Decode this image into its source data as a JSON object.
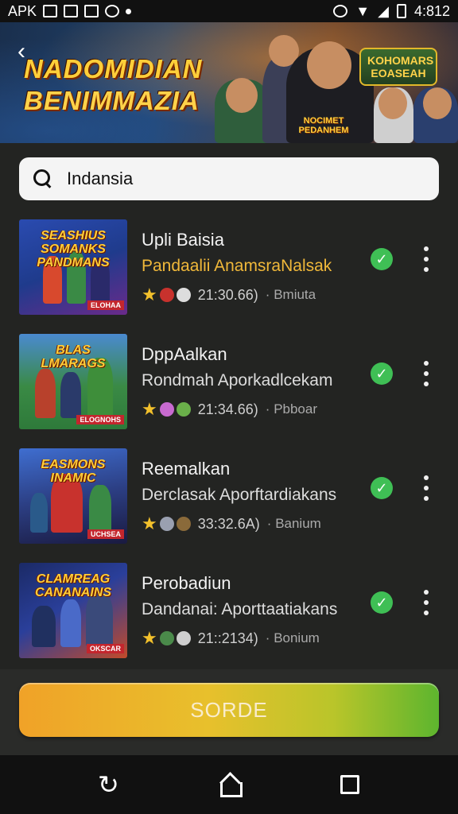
{
  "status_bar": {
    "left_label": "APK",
    "time": "4:812"
  },
  "banner": {
    "title_line1": "NADOMIDIAN",
    "title_line2": "BENIMMAZIA",
    "shirt_text": "NOCIMET PEDANHEM",
    "badge_text": "KOHOMARS EOASEAH"
  },
  "search": {
    "value": "Indansia",
    "placeholder": ""
  },
  "results": [
    {
      "thumb_title": "SEASHIUS SOMANKS PANDMANS",
      "thumb_tag": "ELOHAA",
      "name": "Upli Baisia",
      "subtitle": "Pandaalii AnamsraNalsak",
      "time": "21:30.66)",
      "category": "Bmiuta",
      "colors": [
        "#1f3b8c",
        "#d8492d",
        "#f2b92a"
      ]
    },
    {
      "thumb_title": "BLAS LMARAGS",
      "thumb_tag": "ELOGNOHS",
      "name": "DppAalkan",
      "subtitle": "Rondmah Aporkadlcekam",
      "time": "21:34.66)",
      "category": "Pbboar",
      "colors": [
        "#2e7a3a",
        "#b8412c",
        "#d8a62a"
      ]
    },
    {
      "thumb_title": "EASMONS INAMIC",
      "thumb_tag": "UCHSEA",
      "name": "Reemalkan",
      "subtitle": "Derclasak Aporftardiakans",
      "time": "33:32.6A)",
      "category": "Banium",
      "colors": [
        "#2c3f84",
        "#c8322d",
        "#3a8a45"
      ]
    },
    {
      "thumb_title": "CLAMREAG CANANAINS",
      "thumb_tag": "OKSCAR",
      "name": "Perobadiun",
      "subtitle": "Dandanai: Aporttaatiakans",
      "time": "21::2134)",
      "category": "Bonium",
      "colors": [
        "#1b2a66",
        "#c24a2a",
        "#4a6ac8"
      ]
    }
  ],
  "action_button": {
    "label": "SORDE"
  }
}
